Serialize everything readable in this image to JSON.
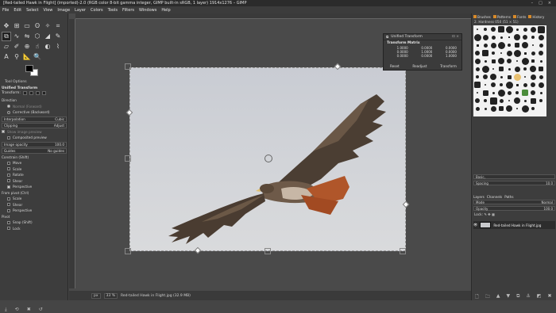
{
  "window": {
    "title": "[Red-tailed Hawk in Flight] (imported)-2.0 (RGB color 8-bit gamma integer, GIMP built-in sRGB, 1 layer) 1914x1276 – GIMP",
    "controls": [
      "–",
      "□",
      "×"
    ]
  },
  "menu": [
    "File",
    "Edit",
    "Select",
    "View",
    "Image",
    "Layer",
    "Colors",
    "Tools",
    "Filters",
    "Windows",
    "Help"
  ],
  "toolbox": {
    "tools": [
      {
        "name": "move-tool-icon",
        "glyph": "✥"
      },
      {
        "name": "align-tool-icon",
        "glyph": "⊞"
      },
      {
        "name": "rect-select-icon",
        "glyph": "▭"
      },
      {
        "name": "free-select-icon",
        "glyph": "ʘ"
      },
      {
        "name": "fuzzy-select-icon",
        "glyph": "✧"
      },
      {
        "name": "crop-tool-icon",
        "glyph": "⌗"
      },
      {
        "name": "unified-transform-icon",
        "glyph": "⧉"
      },
      {
        "name": "warp-transform-icon",
        "glyph": "∿"
      },
      {
        "name": "flip-tool-icon",
        "glyph": "⇋"
      },
      {
        "name": "cage-tool-icon",
        "glyph": "⬡"
      },
      {
        "name": "bucket-fill-icon",
        "glyph": "◢"
      },
      {
        "name": "paintbrush-icon",
        "glyph": "✎"
      },
      {
        "name": "eraser-icon",
        "glyph": "▱"
      },
      {
        "name": "airbrush-icon",
        "glyph": "✐"
      },
      {
        "name": "clone-tool-icon",
        "glyph": "⊕"
      },
      {
        "name": "smudge-tool-icon",
        "glyph": "☝"
      },
      {
        "name": "dodge-burn-icon",
        "glyph": "◐"
      },
      {
        "name": "paths-tool-icon",
        "glyph": "⌇"
      },
      {
        "name": "text-tool-icon",
        "glyph": "A"
      },
      {
        "name": "color-picker-icon",
        "glyph": "⚲"
      },
      {
        "name": "measure-tool-icon",
        "glyph": "📐"
      },
      {
        "name": "zoom-tool-icon",
        "glyph": "🔍"
      }
    ]
  },
  "tool_options": {
    "header": "Tool Options",
    "title": "Unified Transform",
    "transform_label": "Transform:",
    "direction_label": "Direction",
    "direction_normal": "Normal (Forward)",
    "direction_corrective": "Corrective (Backward)",
    "interpolation_label": "Interpolation",
    "interpolation_value": "Cubic",
    "clipping_label": "Clipping",
    "clipping_value": "Adjust",
    "show_image_preview": "Show image preview",
    "composited_preview": "Composited preview",
    "image_opacity_label": "Image opacity",
    "image_opacity_value": "100.0",
    "guides_label": "Guides",
    "guides_value": "No guides",
    "constrain_label": "Constrain (Shift)",
    "constrain_items": [
      "Move",
      "Scale",
      "Rotate",
      "Shear",
      "Perspective"
    ],
    "from_pivot_label": "From pivot (Ctrl)",
    "from_pivot_items": [
      "Scale",
      "Shear",
      "Perspective"
    ],
    "pivot_label": "Pivot",
    "pivot_items": [
      "Snap (Shift)",
      "Lock"
    ]
  },
  "transform_dialog": {
    "title": "Unified Transform",
    "subtitle": "Transform Matrix",
    "matrix": [
      "1.0000",
      "0.0000",
      "0.0000",
      "0.0000",
      "1.0000",
      "0.0000",
      "0.0000",
      "0.0000",
      "1.0000"
    ],
    "buttons": [
      "Reset",
      "Readjust",
      "Transform"
    ]
  },
  "status": {
    "unit": "px",
    "zoom": "33 %",
    "info": "Red-tailed Hawk in Flight.jpg (32.9 MB)"
  },
  "right_dock": {
    "tabs": [
      "Brushes",
      "Patterns",
      "Fonts",
      "History"
    ],
    "brush_label": "2. Hardness 050 (51 × 51)",
    "tag_field": "Basic,",
    "spacing_label": "Spacing",
    "spacing_value": "10.0",
    "layer_tabs": [
      "Layers",
      "Channels",
      "Paths"
    ],
    "mode_label": "Mode",
    "mode_value": "Normal",
    "opacity_label": "Opacity",
    "opacity_value": "100.0",
    "lock_label": "Lock:",
    "layer_name": "Red-tailed Hawk in Flight.jpg"
  }
}
